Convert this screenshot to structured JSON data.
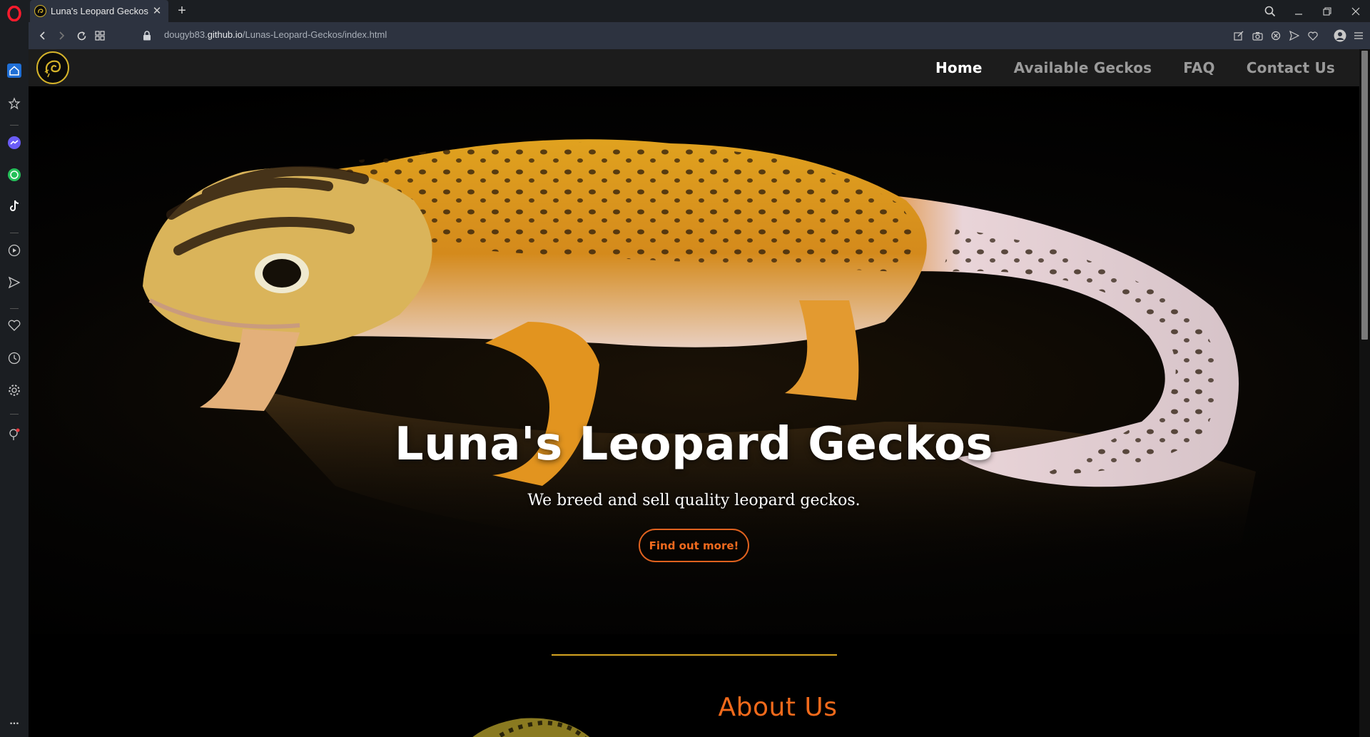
{
  "browser": {
    "tab": {
      "title": "Luna's Leopard Geckos | Home",
      "close": "✕"
    },
    "new_tab": "+",
    "url": {
      "host_prefix": "dougyb83.",
      "host_domain": "github.io",
      "path": "/Lunas-Leopard-Geckos/index.html"
    },
    "window_controls": [
      "search-icon",
      "minimize-icon",
      "restore-icon",
      "close-icon"
    ],
    "nav_icons": [
      "back-icon",
      "forward-icon",
      "reload-icon",
      "tabs-grid-icon"
    ],
    "address_icons": [
      "edit-icon",
      "camera-icon",
      "block-icon",
      "send-icon",
      "heart-icon",
      "profile-icon",
      "menu-icon"
    ],
    "sidebar_icons": [
      "home-icon",
      "star-icon",
      "messenger-icon",
      "whatsapp-icon",
      "tiktok-icon",
      "player-icon",
      "send-icon",
      "heart-icon",
      "history-icon",
      "settings-icon",
      "lightbulb-icon",
      "more-icon"
    ],
    "more_label": "..."
  },
  "site": {
    "nav": {
      "links": [
        {
          "label": "Home",
          "active": true
        },
        {
          "label": "Available Geckos",
          "active": false
        },
        {
          "label": "FAQ",
          "active": false
        },
        {
          "label": "Contact Us",
          "active": false
        }
      ]
    },
    "hero": {
      "title": "Luna's Leopard Geckos",
      "subtitle": "We breed and sell quality leopard geckos.",
      "button": "Find out more!"
    },
    "about": {
      "title": "About Us"
    },
    "colors": {
      "accent": "#f26a1b",
      "gold": "#d6a521",
      "nav_bg": "#1c1c1c"
    }
  }
}
